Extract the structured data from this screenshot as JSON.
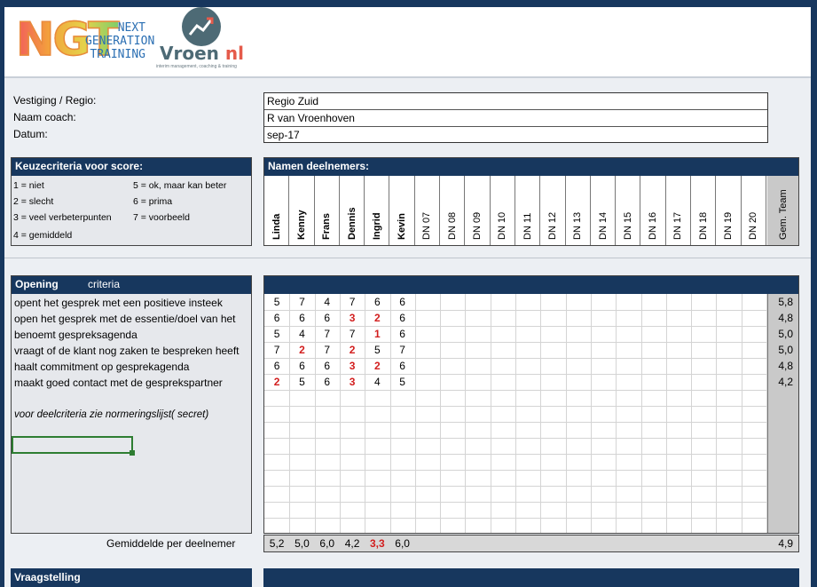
{
  "logos": {
    "ngt_letters": "NGT",
    "ngt_words": [
      "NEXT",
      "GENERATION",
      "TRAINING"
    ],
    "vroen_name": "Vroen",
    "vroen_suffix": " nl",
    "vroen_tagline": "interim management, coaching & training"
  },
  "info": {
    "labels": [
      "Vestiging / Regio:",
      "Naam coach:",
      "Datum:"
    ],
    "values": [
      "Regio Zuid",
      "R van Vroenhoven",
      "sep-17"
    ]
  },
  "keuze": {
    "title": "Keuzecriteria voor score:",
    "col1": [
      "1 = niet",
      "2 = slecht",
      "3 = veel verbeterpunten",
      "4 = gemiddeld"
    ],
    "col2": [
      "5 = ok, maar kan beter",
      "6 = prima",
      "7 = voorbeeld"
    ]
  },
  "deelnemers": {
    "title": "Namen deelnemers:",
    "names": [
      "Linda",
      "Kenny",
      "Frans",
      "Dennis",
      "Ingrid",
      "Kevin",
      "DN 07",
      "DN 08",
      "DN 09",
      "DN 10",
      "DN 11",
      "DN 12",
      "DN 13",
      "DN 14",
      "DN 15",
      "DN 16",
      "DN 17",
      "DN 18",
      "DN 19",
      "DN 20"
    ],
    "team_label": "Gem. Team"
  },
  "opening": {
    "title": "Opening",
    "subtitle": "criteria",
    "criteria": [
      "opent het gesprek met een positieve insteek",
      "open het gesprek met de essentie/doel van het",
      "benoemt gespreksagenda",
      "vraagt of de klant nog zaken te bespreken heeft",
      "haalt commitment op gesprekagenda",
      "maakt goed contact met de gesprekspartner"
    ],
    "note": "voor deelcriteria zie normeringslijst( secret)",
    "scores": [
      [
        5,
        7,
        4,
        7,
        6,
        6
      ],
      [
        6,
        6,
        6,
        3,
        2,
        6
      ],
      [
        5,
        4,
        7,
        7,
        1,
        6
      ],
      [
        7,
        2,
        7,
        2,
        5,
        7
      ],
      [
        6,
        6,
        6,
        3,
        2,
        6
      ],
      [
        2,
        5,
        6,
        3,
        4,
        5
      ]
    ],
    "team_averages": [
      "5,8",
      "4,8",
      "5,0",
      "5,0",
      "4,8",
      "4,2"
    ],
    "avg_label": "Gemiddelde per deelnemer",
    "avg_per_participant": [
      "5,2",
      "5,0",
      "6,0",
      "4,2",
      "3,3",
      "6,0"
    ],
    "avg_team": "4,9"
  },
  "vraagstelling": {
    "title": "Vraagstelling"
  },
  "colors": {
    "header_blue": "#17375e",
    "low_score_red": "#d21e1e"
  }
}
